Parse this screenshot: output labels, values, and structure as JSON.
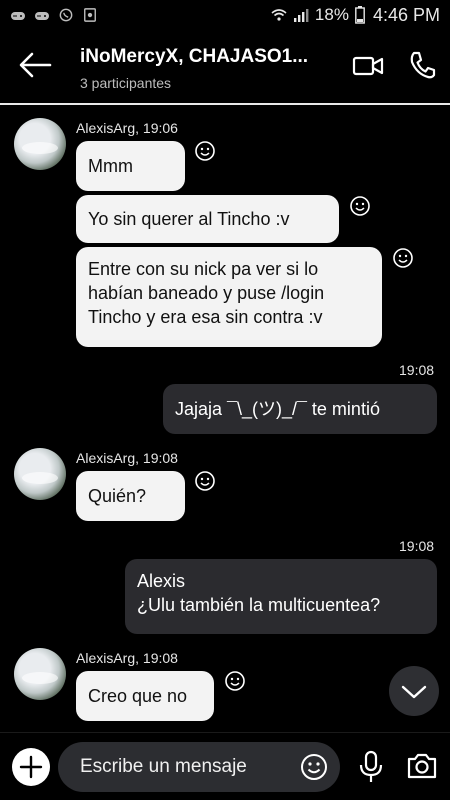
{
  "status_bar": {
    "battery": "18%",
    "time": "4:46 PM"
  },
  "header": {
    "title": "iNoMercyX, CHAJASO1...",
    "subtitle": "3 participantes"
  },
  "messages": [
    {
      "sender": "AlexisArg, 19:06",
      "texts": [
        "Mmm",
        "Yo sin querer al Tincho :v",
        "Entre con su nick pa ver si lo habían baneado y puse /login Tincho y era esa sin contra :v"
      ]
    },
    {
      "time": "19:08",
      "text": "Jajaja ¯\\_(ツ)_/¯ te mintió"
    },
    {
      "sender": "AlexisArg, 19:08",
      "text": "Quién?"
    },
    {
      "time": "19:08",
      "text_line1": "Alexis",
      "text_line2": "¿Ulu también la multicuentea?"
    },
    {
      "sender": "AlexisArg, 19:08",
      "text": "Creo que no"
    }
  ],
  "input": {
    "placeholder": "Escribe un mensaje"
  }
}
